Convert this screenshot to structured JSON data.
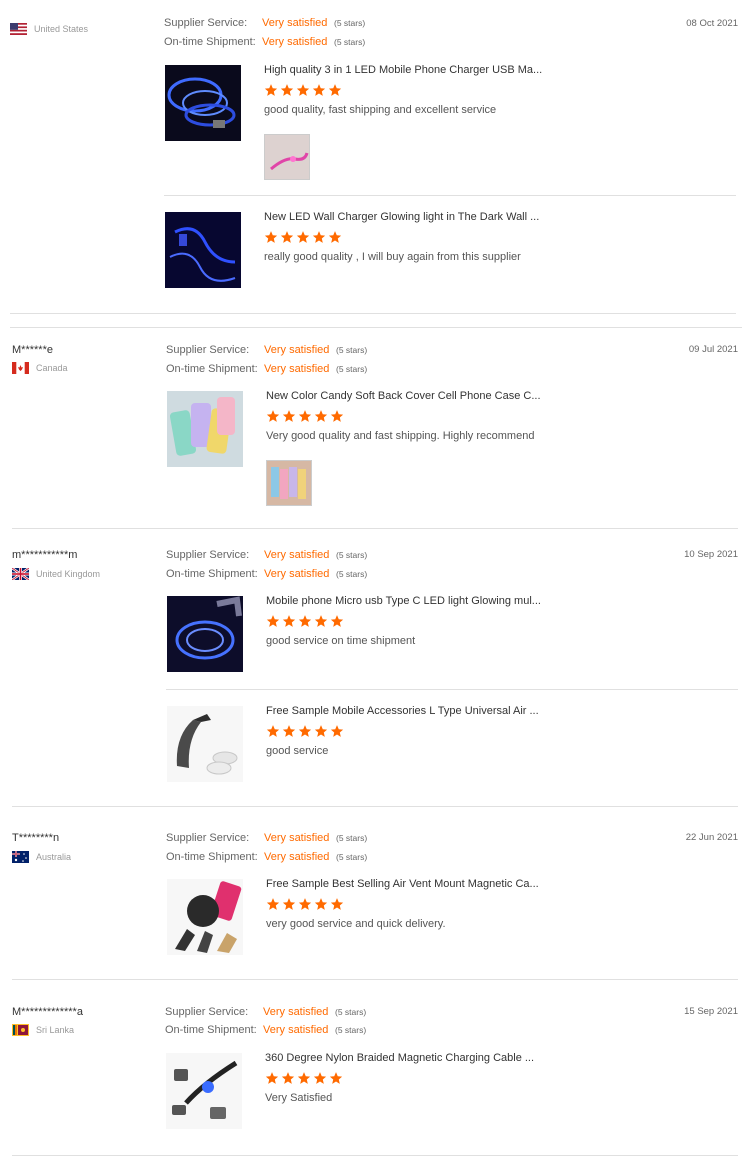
{
  "colors": {
    "accent": "#ff6a00",
    "divider": "#e0e0e0"
  },
  "reviews": [
    {
      "buyer": "",
      "country": "United States",
      "flag": "us-flag",
      "supplier_label": "Supplier Service:",
      "supplier_value": "Very satisfied",
      "supplier_stars": "(5 stars)",
      "shipment_label": "On-time Shipment:",
      "shipment_value": "Very satisfied",
      "shipment_stars": "(5 stars)",
      "date": "08 Oct 2021",
      "products": [
        {
          "title": "High quality 3 in 1 LED Mobile Phone Charger USB Ma...",
          "rating": 5,
          "comment": "good quality, fast shipping and excellent service",
          "image": "led-charger-cable-photo",
          "attachment": "pink-cable-photo"
        },
        {
          "title": "New LED Wall Charger Glowing light in The Dark Wall ...",
          "rating": 5,
          "comment": "really good quality , I will buy again from this supplier",
          "image": "blue-glowing-cable-photo"
        }
      ]
    },
    {
      "buyer": "M******e",
      "country": "Canada",
      "flag": "canada-flag",
      "supplier_label": "Supplier Service:",
      "supplier_value": "Very satisfied",
      "supplier_stars": "(5 stars)",
      "shipment_label": "On-time Shipment:",
      "shipment_value": "Very satisfied",
      "shipment_stars": "(5 stars)",
      "date": "09 Jul 2021",
      "products": [
        {
          "title": "New Color Candy Soft Back Cover Cell Phone Case C...",
          "rating": 5,
          "comment": "Very good quality and fast shipping. Highly recommend",
          "image": "candy-phone-cases-photo",
          "attachment": "phone-cases-box-photo"
        }
      ]
    },
    {
      "buyer": "m***********m",
      "country": "United Kingdom",
      "flag": "uk-flag",
      "supplier_label": "Supplier Service:",
      "supplier_value": "Very satisfied",
      "supplier_stars": "(5 stars)",
      "shipment_label": "On-time Shipment:",
      "shipment_value": "Very satisfied",
      "shipment_stars": "(5 stars)",
      "date": "10 Sep 2021",
      "products": [
        {
          "title": "Mobile phone Micro usb Type C LED light Glowing mul...",
          "rating": 5,
          "comment": "good service on time shipment",
          "image": "glowing-usb-cable-photo"
        },
        {
          "title": "Free Sample Mobile Accessories L Type Universal Air ...",
          "rating": 5,
          "comment": "good service",
          "image": "car-phone-holder-photo"
        }
      ]
    },
    {
      "buyer": "T********n",
      "country": "Australia",
      "flag": "australia-flag",
      "supplier_label": "Supplier Service:",
      "supplier_value": "Very satisfied",
      "supplier_stars": "(5 stars)",
      "shipment_label": "On-time Shipment:",
      "shipment_value": "Very satisfied",
      "shipment_stars": "(5 stars)",
      "date": "22 Jun 2021",
      "products": [
        {
          "title": "Free Sample Best Selling Air Vent Mount Magnetic Ca...",
          "rating": 5,
          "comment": "very good service and quick delivery.",
          "image": "magnetic-car-mount-photo"
        }
      ]
    },
    {
      "buyer": "M*************a",
      "country": "Sri Lanka",
      "flag": "sri-lanka-flag",
      "supplier_label": "Supplier Service:",
      "supplier_value": "Very satisfied",
      "supplier_stars": "(5 stars)",
      "shipment_label": "On-time Shipment:",
      "shipment_value": "Very satisfied",
      "shipment_stars": "(5 stars)",
      "date": "15 Sep 2021",
      "products": [
        {
          "title": "360 Degree Nylon Braided Magnetic Charging Cable ...",
          "rating": 5,
          "comment": "Very Satisfied",
          "image": "magnetic-charging-cable-photo"
        }
      ]
    }
  ]
}
